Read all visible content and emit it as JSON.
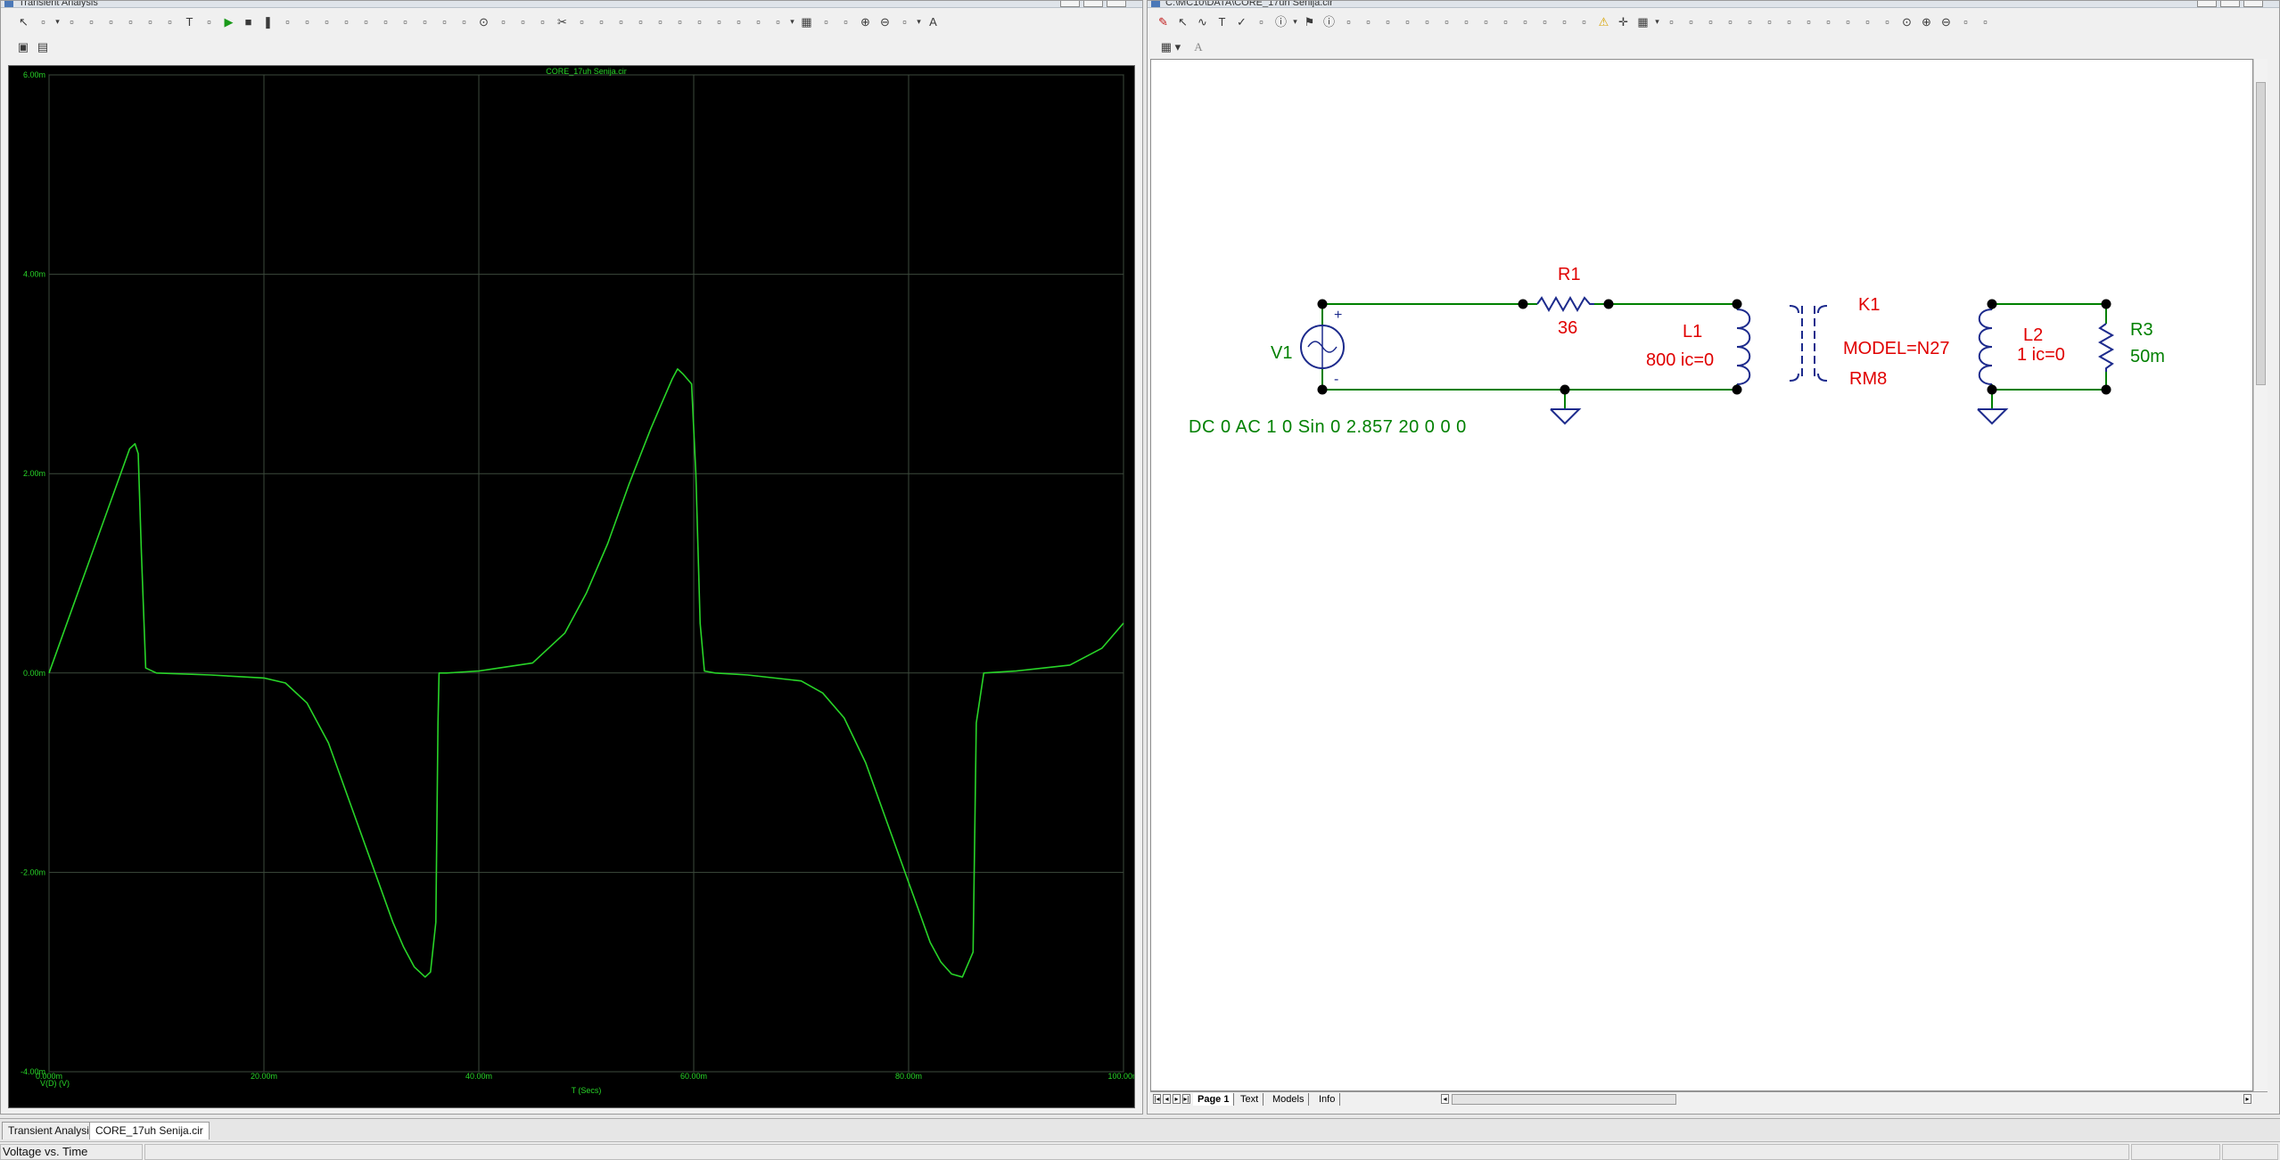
{
  "left_window": {
    "title": "Transient Analysis",
    "icon": "analysis-window-icon",
    "toolbar_icons": [
      "select-arrow-icon",
      "transient-icon",
      "dropdown-icon",
      "icon-a",
      "icon-b",
      "icon-c",
      "icon-d",
      "icon-e",
      "icon-f",
      "text-icon",
      "properties-icon",
      "run-icon",
      "stop-icon",
      "pause-icon",
      "graph-icon",
      "graph2-icon",
      "box1-icon",
      "box2-icon",
      "box3-icon",
      "box4-icon",
      "box5-icon",
      "box6-icon",
      "box7-icon",
      "box8-icon",
      "zoom-fit-icon",
      "zoom-in-all-icon",
      "zoom-out-all-icon",
      "zoom-x-icon",
      "cut-icon",
      "grid1-icon",
      "grid2-icon",
      "slope-icon",
      "peak-icon",
      "valley-icon",
      "high-icon",
      "low-icon",
      "inflect-icon",
      "global-high-icon",
      "global-low-icon",
      "tag-icon",
      "dropdown-icon",
      "table-icon",
      "list-icon",
      "fit-icon",
      "zoom-in-icon",
      "zoom-out-icon",
      "options-icon",
      "dropdown-icon",
      "font-icon"
    ]
  },
  "right_window": {
    "title": "C:\\MC10\\DATA\\CORE_17uh Senija.cir",
    "toolbar_icons": [
      "pen-icon",
      "select-icon",
      "wire-icon",
      "text-tool-icon",
      "check-icon",
      "component-icon",
      "info-icon",
      "dropdown-icon",
      "flag-icon",
      "circle-i-icon",
      "capture-icon",
      "b1-icon",
      "b2-icon",
      "b3-icon",
      "b4-icon",
      "b5-icon",
      "b6-icon",
      "b7-icon",
      "b8-icon",
      "b9-icon",
      "b10-icon",
      "b11-icon",
      "b12-icon",
      "warning-icon",
      "plus-icon",
      "grid-icon",
      "dropdown-icon",
      "page-icon",
      "page2-icon",
      "page3-icon",
      "page4-icon",
      "page5-icon",
      "page6-icon",
      "page7-icon",
      "page8-icon",
      "page9-icon",
      "page10-icon",
      "page11-icon",
      "page12-icon",
      "zoom-fit-icon",
      "zoom-in-icon",
      "zoom-out-icon",
      "zoom-area-icon",
      "settings-icon"
    ],
    "secondary_toolbar": {
      "grid_label": "▦ ▾",
      "font_label": "A"
    },
    "sheet_tabs": [
      "Page 1",
      "Text",
      "Models",
      "Info"
    ]
  },
  "plot": {
    "title": "CORE_17uh Senija.cir",
    "x_title": "T (Secs)",
    "series_label": "V(D) (V)",
    "trace_color": "#28d428",
    "grid_color": "#3c4a3c",
    "background": "#000000"
  },
  "chart_data": {
    "type": "line",
    "title": "CORE_17uh Senija.cir",
    "xlabel": "T (Secs)",
    "ylabel": "",
    "xlim": [
      0,
      100
    ],
    "ylim": [
      -4,
      6
    ],
    "x_unit_suffix": "m",
    "y_unit_suffix": "m",
    "x_ticks": [
      0,
      20,
      40,
      60,
      80,
      100
    ],
    "y_ticks": [
      -4,
      -2,
      0,
      2,
      4,
      6
    ],
    "x_tick_labels": [
      "0.000m",
      "20.00m",
      "40.00m",
      "60.00m",
      "80.00m",
      "100.00m"
    ],
    "y_tick_labels": [
      "-4.00m",
      "-2.00m",
      "0.00m",
      "2.00m",
      "4.00m",
      "6.00m"
    ],
    "grid": true,
    "series": [
      {
        "name": "V(D) (V)",
        "x": [
          0,
          2,
          4,
          6,
          7,
          7.5,
          8,
          8.3,
          8.6,
          9,
          10,
          15,
          20,
          22,
          24,
          26,
          28,
          30,
          32,
          33,
          34,
          35,
          35.5,
          36,
          36.2,
          36.3,
          37,
          40,
          45,
          48,
          50,
          52,
          54,
          56,
          57,
          58,
          58.5,
          59,
          59.8,
          60.2,
          60.6,
          61,
          62,
          65,
          70,
          72,
          74,
          76,
          78,
          80,
          81,
          82,
          83,
          84,
          85,
          86,
          86.3,
          87,
          90,
          95,
          98,
          100
        ],
        "y": [
          0,
          0.6,
          1.2,
          1.8,
          2.1,
          2.25,
          2.3,
          2.2,
          1.2,
          0.05,
          0,
          -0.02,
          -0.05,
          -0.1,
          -0.3,
          -0.7,
          -1.3,
          -1.9,
          -2.5,
          -2.75,
          -2.95,
          -3.05,
          -3.0,
          -2.5,
          -0.5,
          0,
          0,
          0.02,
          0.1,
          0.4,
          0.8,
          1.3,
          1.9,
          2.45,
          2.7,
          2.95,
          3.05,
          3.0,
          2.9,
          2.0,
          0.5,
          0.02,
          0,
          -0.02,
          -0.08,
          -0.2,
          -0.45,
          -0.9,
          -1.5,
          -2.1,
          -2.4,
          -2.7,
          -2.9,
          -3.02,
          -3.05,
          -2.8,
          -0.5,
          0,
          0.02,
          0.08,
          0.25,
          0.5
        ]
      }
    ]
  },
  "schematic": {
    "wire_color": "#008000",
    "component_color": "#1c2a8c",
    "label_red": "#e00000",
    "label_green": "#008000",
    "V1": {
      "name": "V1",
      "value": "DC 0 AC 1 0 Sin 0 2.857 20 0 0 0"
    },
    "R1": {
      "name": "R1",
      "value": "36"
    },
    "L1": {
      "name": "L1",
      "value": "800 ic=0"
    },
    "K1": {
      "name": "K1",
      "model": "MODEL=N27",
      "core": "RM8"
    },
    "L2": {
      "name": "L2",
      "value": "1 ic=0"
    },
    "R3": {
      "name": "R3",
      "value": "50m"
    }
  },
  "doc_tabs": [
    "Transient Analysis",
    "CORE_17uh Senija.cir"
  ],
  "status": {
    "text": "Voltage vs. Time"
  }
}
